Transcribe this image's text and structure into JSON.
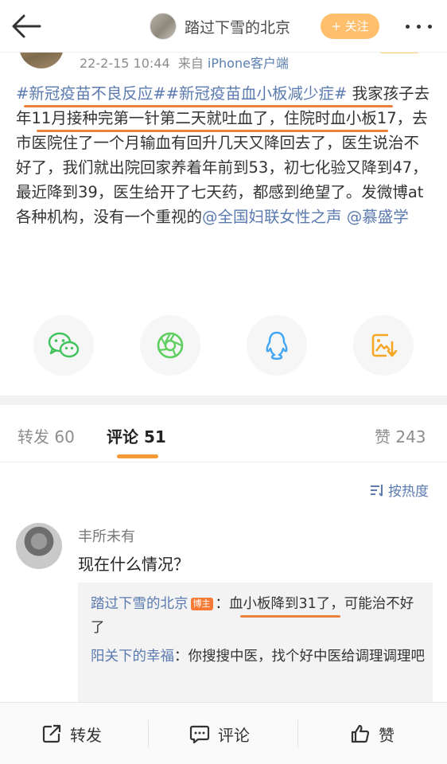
{
  "nav": {
    "title": "踏过下雪的北京",
    "follow_label": "+ 关注"
  },
  "post": {
    "time": "22-2-15 10:44",
    "source_prefix": "来自",
    "source": "iPhone客户端",
    "tag1": "#新冠疫苗不良反应#",
    "tag2": "#新冠疫苗血小板减少症#",
    "text_main": " 我家孩子去年11月接种完第一针第二天就吐血了，住院时血小板17，去市医院住了一个月输血有回升几天又降回去了，医生说治不好了，我们就出院回家养着年前到53，初七化验又降到47，最近降到39，医生给开了七天药，都感到绝望了。发微博at各种机构，没有一个重视的",
    "mention1": "@全国妇联女性之声",
    "mention2": " @慕盛学"
  },
  "share": {
    "icons": [
      "wechat-icon",
      "moments-icon",
      "qq-icon",
      "save-image-icon"
    ],
    "colors": {
      "wechat": "#3fc35a",
      "moments": "#5ccf5f",
      "qq": "#40a5f5",
      "save": "#f5a623"
    }
  },
  "tabs": {
    "repost": "转发 60",
    "comment": "评论 51",
    "like": "赞 243"
  },
  "sort_label": "按热度",
  "comment": {
    "name": "丰所未有",
    "text": "现在什么情况？",
    "replies": [
      {
        "name": "踏过下雪的北京",
        "badge": "博主",
        "text": "：血小板降到31了，可能治不好了"
      },
      {
        "name": "阳关下的幸福",
        "text": "：你搜搜中医，找个好中医给调理调理吧"
      }
    ]
  },
  "bottom": {
    "repost": "转发",
    "comment": "评论",
    "like": "赞"
  },
  "colors": {
    "accent_orange": "#f59a37",
    "link_blue": "#5a7ab0",
    "underline": "#e9823d"
  }
}
